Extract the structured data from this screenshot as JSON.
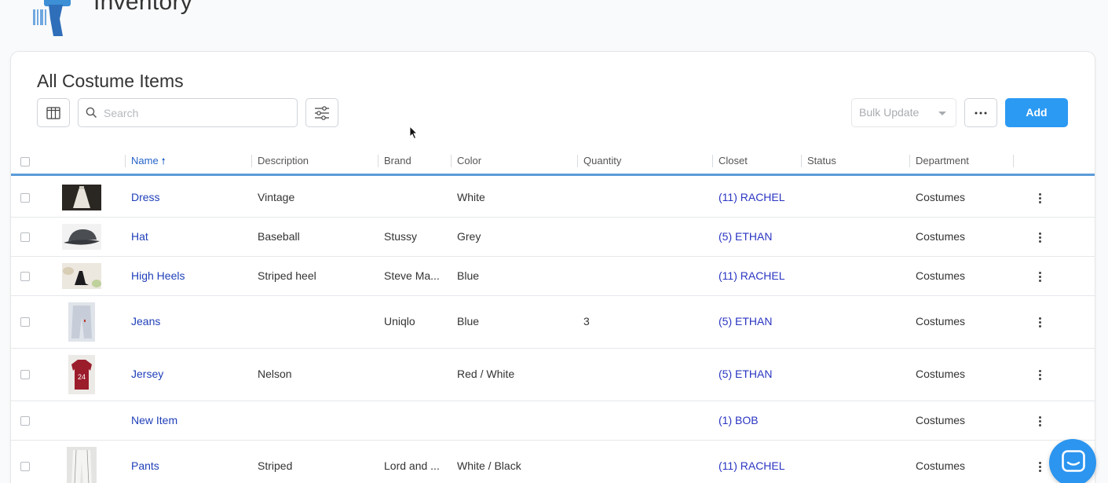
{
  "app": {
    "title": "Inventory"
  },
  "page": {
    "title": "All Costume Items"
  },
  "toolbar": {
    "search_placeholder": "Search",
    "bulk_update_label": "Bulk Update",
    "more_label": "...",
    "add_label": "Add"
  },
  "columns": {
    "name": "Name",
    "description": "Description",
    "brand": "Brand",
    "color": "Color",
    "quantity": "Quantity",
    "closet": "Closet",
    "status": "Status",
    "department": "Department"
  },
  "sort": {
    "column": "Name",
    "direction": "ascending"
  },
  "rows": [
    {
      "name": "Dress",
      "description": "Vintage",
      "brand": "",
      "color": "White",
      "quantity": "",
      "closet": "(11) RACHEL",
      "status": "",
      "department": "Costumes",
      "has_image": true
    },
    {
      "name": "Hat",
      "description": "Baseball",
      "brand": "Stussy",
      "color": "Grey",
      "quantity": "",
      "closet": "(5) ETHAN",
      "status": "",
      "department": "Costumes",
      "has_image": true
    },
    {
      "name": "High Heels",
      "description": "Striped heel",
      "brand": "Steve Ma...",
      "color": "Blue",
      "quantity": "",
      "closet": "(11) RACHEL",
      "status": "",
      "department": "Costumes",
      "has_image": true
    },
    {
      "name": "Jeans",
      "description": "",
      "brand": "Uniqlo",
      "color": "Blue",
      "quantity": "3",
      "closet": "(5) ETHAN",
      "status": "",
      "department": "Costumes",
      "has_image": true
    },
    {
      "name": "Jersey",
      "description": "Nelson",
      "brand": "",
      "color": "Red / White",
      "quantity": "",
      "closet": "(5) ETHAN",
      "status": "",
      "department": "Costumes",
      "has_image": true
    },
    {
      "name": "New Item",
      "description": "",
      "brand": "",
      "color": "",
      "quantity": "",
      "closet": "(1) BOB",
      "status": "",
      "department": "Costumes",
      "has_image": false
    },
    {
      "name": "Pants",
      "description": "Striped",
      "brand": "Lord and ...",
      "color": "White / Black",
      "quantity": "",
      "closet": "(11) RACHEL",
      "status": "",
      "department": "Costumes",
      "has_image": true
    }
  ],
  "colors": {
    "accent": "#2b9af3",
    "link": "#1f3fb8",
    "header_rule": "#5a9bd8"
  },
  "icons": [
    "barcode-scanner-logo-icon",
    "columns-icon",
    "search-icon",
    "filter-sliders-icon",
    "chevron-down-icon",
    "more-horizontal-icon",
    "more-vertical-icon",
    "chat-icon",
    "sort-up-icon"
  ]
}
